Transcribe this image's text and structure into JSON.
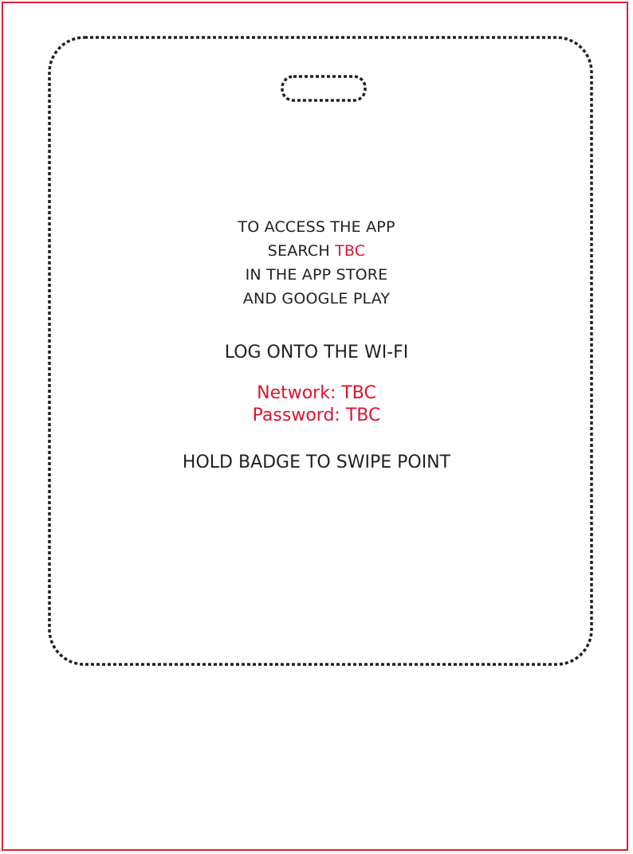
{
  "colors": {
    "border": "#e41e2b",
    "highlight": "#e2112c",
    "text": "#231f20",
    "cutline": "#231f20"
  },
  "app_instructions": {
    "line1": "TO ACCESS THE APP",
    "line2_prefix": "SEARCH ",
    "line2_highlight": "TBC",
    "line3": "IN THE APP STORE",
    "line4": "AND GOOGLE PLAY"
  },
  "wifi": {
    "heading": "LOG ONTO THE WI-FI",
    "network": "Network: TBC",
    "password": "Password: TBC"
  },
  "badge": {
    "instruction": "HOLD BADGE TO SWIPE POINT"
  }
}
